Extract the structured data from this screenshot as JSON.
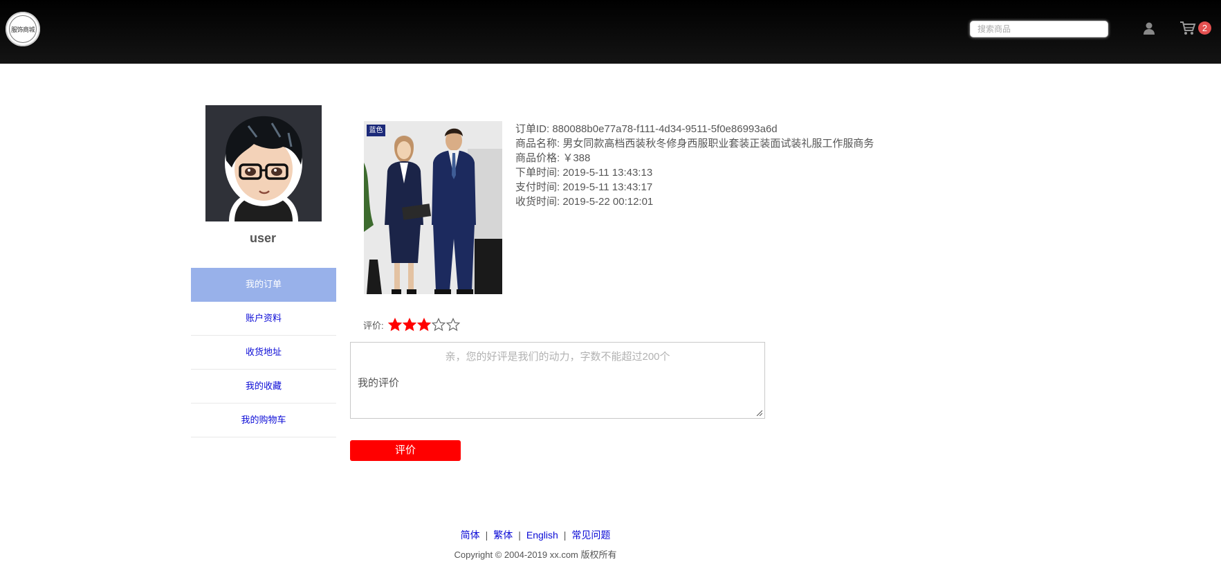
{
  "header": {
    "logo_text": "服饰商城",
    "search_placeholder": "搜索商品",
    "cart_count": "2"
  },
  "profile": {
    "username": "user"
  },
  "side_nav": [
    {
      "label": "我的订单",
      "active": true
    },
    {
      "label": "账户资料",
      "active": false
    },
    {
      "label": "收货地址",
      "active": false
    },
    {
      "label": "我的收藏",
      "active": false
    },
    {
      "label": "我的购物车",
      "active": false
    }
  ],
  "product": {
    "color_tag": "蓝色"
  },
  "order": {
    "id_line": "订单ID: 880088b0e77a78-f111-4d34-9511-5f0e86993a6d",
    "name_line": "商品名称:  男女同款高档西装秋冬修身西服职业套装正装面试装礼服工作服商务",
    "price_line": "商品价格:  ￥388",
    "order_time_line": "下单时间: 2019-5-11 13:43:13",
    "pay_time_line": "支付时间: 2019-5-11 13:43:17",
    "receive_time_line": "收货时间: 2019-5-22 00:12:01"
  },
  "rating": {
    "label": "评价:",
    "value": 3,
    "max": 5,
    "filled_color": "#ff0000"
  },
  "comment": {
    "placeholder": "亲，您的好评是我们的动力，字数不能超过200个",
    "value": "我的评价"
  },
  "submit_label": "评价",
  "footer": {
    "links": [
      "简体",
      "繁体",
      "English",
      "常见问题"
    ],
    "copyright": "Copyright © 2004-2019 xx.com 版权所有"
  }
}
